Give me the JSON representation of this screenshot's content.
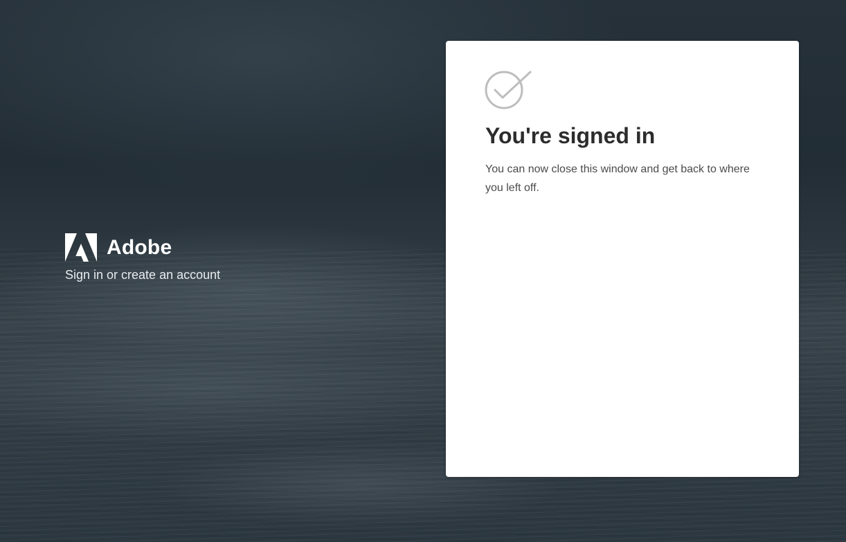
{
  "brand": {
    "name": "Adobe",
    "tagline": "Sign in or create an account",
    "logo_icon": "adobe-logo-icon"
  },
  "card": {
    "status_icon": "checkmark-circle-icon",
    "title": "You're signed in",
    "message": "You can now close this window and get back to where you left off."
  },
  "colors": {
    "card_background": "#ffffff",
    "heading_text": "#2c2c2c",
    "body_text": "#4b4b4b",
    "icon_gray": "#bdbdbd",
    "backdrop": "#2a353d"
  }
}
